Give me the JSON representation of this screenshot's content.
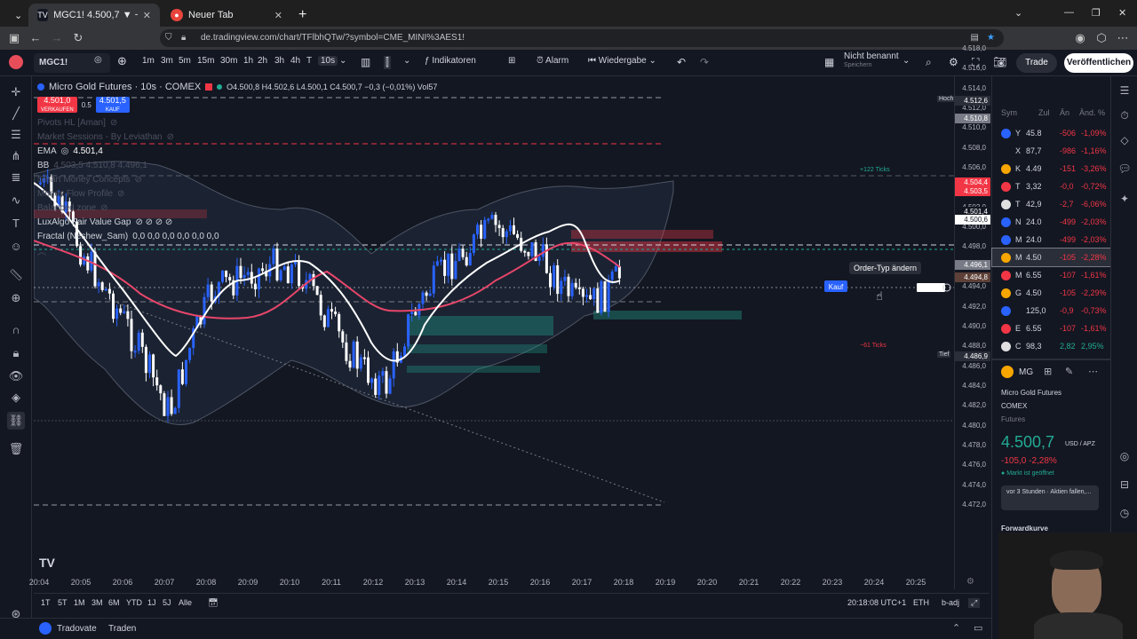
{
  "browser": {
    "tabs": [
      {
        "label": "MGC1! 4.500,7 ▼ −2.28% Nicht",
        "active": true
      },
      {
        "label": "Neuer Tab",
        "active": false
      }
    ],
    "url": "de.tradingview.com/chart/TFlbhQTw/?symbol=CME_MINI%3AES1!"
  },
  "toolbar": {
    "symbol": "MGC1!",
    "intervals": [
      "1m",
      "3m",
      "5m",
      "15m",
      "30m",
      "1h",
      "2h",
      "3h",
      "4h",
      "T",
      "10s"
    ],
    "selected_interval": "10s",
    "indicators_label": "Indikatoren",
    "alarm_label": "Alarm",
    "replay_label": "Wiedergabe",
    "layout_name": "Nicht benannt",
    "layout_sub": "Speichern",
    "trade_label": "Trade",
    "publish_label": "Veröffentlichen"
  },
  "legend": {
    "title": "Micro Gold Futures · 10s · COMEX",
    "ohlc": "O4.500,8 H4.502,6 L4.500,1 C4.500,7 −0,3 (−0,01%) Vol57",
    "sell_price": "4.501,0",
    "sell_label": "VERKAUFEN",
    "spread": "0.5",
    "buy_price": "4.501,5",
    "buy_label": "KAUF",
    "pivots": "Pivots HL [Aman]",
    "sessions": "Market Sessions - By Leviathan",
    "ema_label": "EMA",
    "ema_value": "4.501,4",
    "bb_label": "BB",
    "bb_values": "4.503,5 4.510,8 4.496,1",
    "smc": "Smart Money Concepts",
    "mfp": "Money Flow Profile",
    "zone": "Balanced zone",
    "fvg": "LuxAlgo Fair Value Gap",
    "fractal": "Fractal (Neshew_Sam)",
    "fractal_values": "0,0 0,0 0,0 0,0 0,0 0,0"
  },
  "order": {
    "tooltip": "Order-Typ ändern",
    "side_label": "Kauf",
    "tick_label_up": "+122 Ticks",
    "tick_label_down": "−61 Ticks"
  },
  "price_scale": {
    "ticks": [
      "4.518,0",
      "4.516,0",
      "4.514,0",
      "4.512,0",
      "4.510,0",
      "4.508,0",
      "4.506,0",
      "4.504,0",
      "4.502,0",
      "4.500,0",
      "4.498,0",
      "4.496,0",
      "4.494,0",
      "4.492,0",
      "4.490,0",
      "4.488,0",
      "4.486,0",
      "4.484,0",
      "4.482,0",
      "4.480,0",
      "4.478,0",
      "4.476,0",
      "4.474,0",
      "4.472,0"
    ],
    "labels": [
      {
        "text": "4.512,6",
        "tag": "Hoch",
        "color": "#2a2e39"
      },
      {
        "text": "4.510,8",
        "tag": "",
        "color": "#787b86"
      },
      {
        "text": "4.504,4",
        "tag": "",
        "color": "#f23645"
      },
      {
        "text": "4.503,5",
        "tag": "",
        "color": "#f23645"
      },
      {
        "text": "4.501,4",
        "tag": "",
        "color": "#131722"
      },
      {
        "text": "4.500,6",
        "tag": "",
        "color": "#ffffff"
      },
      {
        "text": "4.496,1",
        "tag": "",
        "color": "#787b86"
      },
      {
        "text": "4.494,8",
        "tag": "",
        "color": "#5d4037"
      },
      {
        "text": "4.486,9",
        "tag": "Tief",
        "color": "#2a2e39"
      }
    ]
  },
  "time_axis": [
    "20:04",
    "20:05",
    "20:06",
    "20:07",
    "20:08",
    "20:09",
    "20:10",
    "20:11",
    "20:12",
    "20:13",
    "20:14",
    "20:15",
    "20:16",
    "20:17",
    "20:18",
    "20:19",
    "20:20",
    "20:21",
    "20:22",
    "20:23",
    "20:24",
    "20:25"
  ],
  "range_bar": {
    "ranges": [
      "1T",
      "5T",
      "1M",
      "3M",
      "6M",
      "YTD",
      "1J",
      "5J",
      "Alle"
    ],
    "clock": "20:18:08 UTC+1",
    "session": "ETH",
    "adj": "b-adj"
  },
  "broker": {
    "name": "Tradovate",
    "action": "Traden"
  },
  "watchlist": {
    "headers": [
      "Sym",
      "Zul",
      "Än",
      "Änd. %"
    ],
    "rows": [
      {
        "sym": "Y",
        "last": "45.8",
        "chg": "-506",
        "pct": "-1,09%",
        "color": "#2962ff"
      },
      {
        "sym": "X",
        "last": "87,7",
        "chg": "-986",
        "pct": "-1,16%",
        "color": "#131722"
      },
      {
        "sym": "K",
        "last": "4.49",
        "chg": "-151",
        "pct": "-3,26%",
        "color": "#f7a600"
      },
      {
        "sym": "T",
        "last": "3,32",
        "chg": "-0,0",
        "pct": "-0,72%",
        "color": "#f23645"
      },
      {
        "sym": "T",
        "last": "42,9",
        "chg": "-2,7",
        "pct": "-6,06%",
        "color": "#e0e0e0"
      },
      {
        "sym": "N",
        "last": "24.0",
        "chg": "-499",
        "pct": "-2,03%",
        "color": "#2962ff"
      },
      {
        "sym": "M",
        "last": "24.0",
        "chg": "-499",
        "pct": "-2,03%",
        "color": "#2962ff"
      },
      {
        "sym": "M",
        "last": "4.50",
        "chg": "-105",
        "pct": "-2,28%",
        "color": "#f7a600"
      },
      {
        "sym": "M",
        "last": "6.55",
        "chg": "-107",
        "pct": "-1,61%",
        "color": "#f23645"
      },
      {
        "sym": "G",
        "last": "4.50",
        "chg": "-105",
        "pct": "-2,29%",
        "color": "#f7a600"
      },
      {
        "sym": "",
        "last": "125,0",
        "chg": "-0,9",
        "pct": "-0,73%",
        "color": "#2962ff"
      },
      {
        "sym": "E",
        "last": "6.55",
        "chg": "-107",
        "pct": "-1,61%",
        "color": "#f23645"
      },
      {
        "sym": "C",
        "last": "98,3",
        "chg": "2,82",
        "pct": "2,95%",
        "color": "#e0e0e0"
      }
    ],
    "detail": {
      "ticker": "MG",
      "name": "Micro Gold Futures",
      "exchange": "COMEX",
      "type": "Futures",
      "price": "4.500,7",
      "currency": "USD / APZ",
      "change": "-105,0 -2,28%",
      "status": "Markt ist geöffnet",
      "news": "vor 3 Stunden · Aktien fallen,...",
      "forward": "Forwardkurve"
    }
  }
}
